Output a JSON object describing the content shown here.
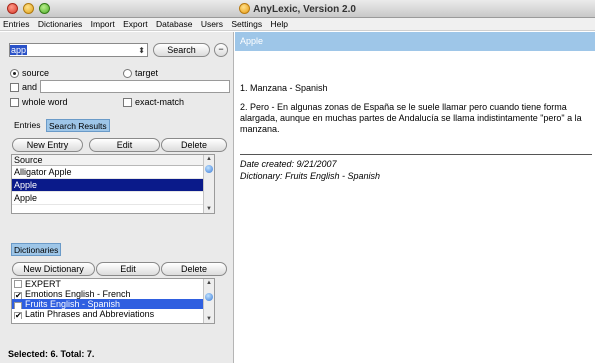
{
  "window": {
    "title": "AnyLexic, Version 2.0"
  },
  "menu": [
    "Entries",
    "Dictionaries",
    "Import",
    "Export",
    "Database",
    "Users",
    "Settings",
    "Help"
  ],
  "search": {
    "value": "app",
    "stepper": "⬍",
    "search_button": "Search",
    "minus_button": "−",
    "radio_source": "source",
    "radio_target": "target",
    "selected_radio": "source",
    "and_label": "and",
    "whole_word_label": "whole word",
    "exact_match_label": "exact-match"
  },
  "entries_panel": {
    "tabs": [
      "Entries",
      "Search Results"
    ],
    "active_tab": "Search Results",
    "buttons": {
      "new": "New Entry",
      "edit": "Edit",
      "delete": "Delete"
    },
    "column_header": "Source",
    "rows": [
      "Alligator Apple",
      "Apple",
      "Apple"
    ],
    "selected_row": 1
  },
  "dictionaries_panel": {
    "tab": "Dictionaries",
    "buttons": {
      "new": "New Dictionary",
      "edit": "Edit",
      "delete": "Delete"
    },
    "rows": [
      {
        "label": "EXPERT",
        "checked": false
      },
      {
        "label": "Emotions English - French",
        "checked": true
      },
      {
        "label": "Fruits English - Spanish",
        "checked": true,
        "selected": true
      },
      {
        "label": "Latin Phrases and Abbreviations",
        "checked": true
      }
    ]
  },
  "status": "Selected: 6. Total: 7.",
  "detail": {
    "header": "Apple",
    "definition_1": "1. Manzana - Spanish",
    "definition_2": "2. Pero - En algunas zonas de España se le suele llamar pero cuando tiene forma alargada, aunque en muchas partes de Andalucía se llama indistintamente \"pero\" a la manzana.",
    "date_created": "Date created: 9/21/2007",
    "dictionary": "Dictionary: Fruits English - Spanish"
  },
  "colors": {
    "accent": "#9ec6e8",
    "selection_dark": "#0a1a8a",
    "selection_light": "#2f5fe0"
  }
}
